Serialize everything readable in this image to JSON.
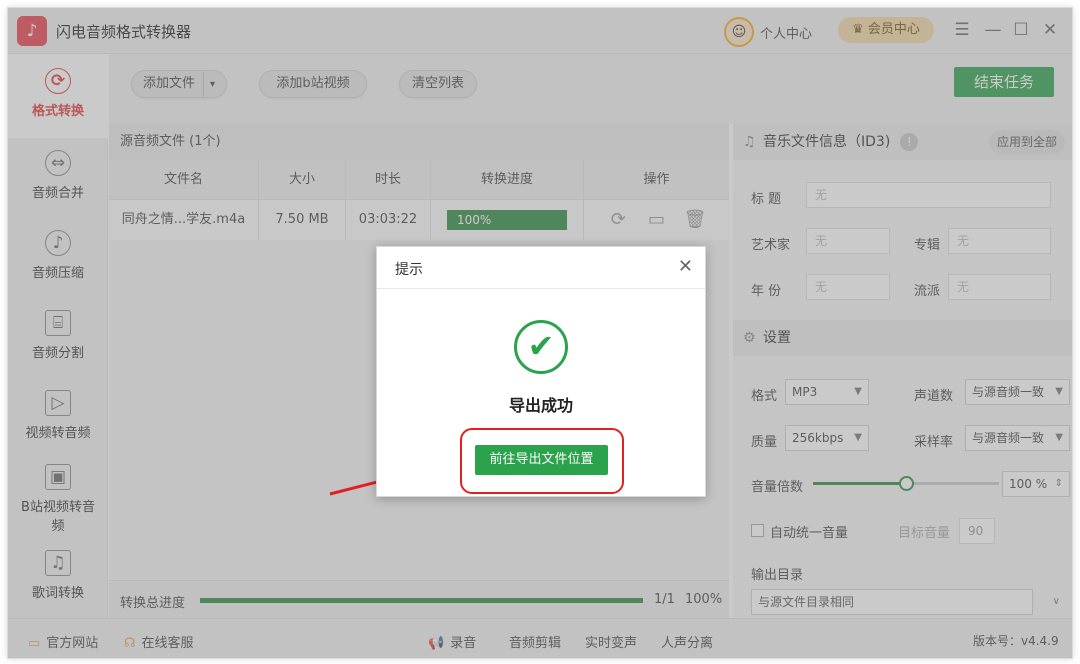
{
  "app": {
    "title": "闪电音频格式转换器",
    "logo_glyph": "♪"
  },
  "header": {
    "avatar_glyph": "☺",
    "personal_center": "个人中心",
    "vip_center": "会员中心",
    "menu_glyph": "☰",
    "minimize_glyph": "—",
    "maximize_glyph": "☐",
    "close_glyph": "✕"
  },
  "sidebar": {
    "items": [
      {
        "label": "格式转换",
        "icon": "refresh-icon",
        "glyph": "⟳"
      },
      {
        "label": "音频合并",
        "icon": "merge-icon",
        "glyph": "⇔"
      },
      {
        "label": "音频压缩",
        "icon": "music-note-icon",
        "glyph": "♪"
      },
      {
        "label": "音频分割",
        "icon": "split-icon",
        "glyph": "⌸"
      },
      {
        "label": "视频转音频",
        "icon": "video-file-icon",
        "glyph": "▷"
      },
      {
        "label": "B站视频转音频",
        "icon": "bilibili-icon",
        "glyph": "▣"
      },
      {
        "label": "歌词转换",
        "icon": "lyrics-icon",
        "glyph": "♫"
      }
    ]
  },
  "toolbar": {
    "add_file": "添加文件",
    "add_file_dropdown": "▾",
    "add_bilibili": "添加b站视频",
    "clear_list": "清空列表",
    "end_task": "结束任务"
  },
  "file_panel": {
    "header": "源音频文件 (1个)",
    "columns": [
      "文件名",
      "大小",
      "时长",
      "转换进度",
      "操作"
    ],
    "rows": [
      {
        "name": "同舟之情...学友.m4a",
        "size": "7.50 MB",
        "duration": "03:03:22",
        "progress_label": "100%",
        "progress": 1.0
      }
    ],
    "op_glyphs": {
      "reconvert": "⟳",
      "open_folder": "▭",
      "delete": "🗑"
    },
    "total_label": "转换总进度",
    "total_count": "1/1",
    "total_percent": "100%",
    "total_progress": 1.0
  },
  "right_panel": {
    "id3_title": "音乐文件信息（ID3)",
    "id3_info_glyph": "!",
    "apply_all": "应用到全部",
    "fields": {
      "title_label": "标 题",
      "artist_label": "艺术家",
      "album_label": "专辑",
      "year_label": "年 份",
      "genre_label": "流派",
      "placeholder": "无"
    },
    "settings_title": "设置",
    "format_label": "格式",
    "format_value": "MP3",
    "channels_label": "声道数",
    "channels_value": "与源音频一致",
    "quality_label": "质量",
    "quality_value": "256kbps",
    "sample_rate_label": "采样率",
    "sample_rate_value": "与源音频一致",
    "volume_label": "音量倍数",
    "volume_value": "100",
    "volume_unit": "%",
    "volume_fraction": 0.5,
    "auto_volume_label": "自动统一音量",
    "target_volume_label": "目标音量",
    "target_volume_value": "90",
    "output_dir_label": "输出目录",
    "output_dir_value": "与源文件目录相同"
  },
  "statusbar": {
    "official_site": "官方网站",
    "online_support": "在线客服",
    "record": "录音",
    "audio_edit": "音频剪辑",
    "realtime_voice": "实时变声",
    "vocal_separation": "人声分离",
    "version": "版本号：v4.4.9"
  },
  "dialog": {
    "title": "提示",
    "close_glyph": "✕",
    "check_glyph": "✔",
    "message": "导出成功",
    "goto_button": "前往导出文件位置"
  },
  "colors": {
    "accent_green": "#2ba24c",
    "highlight_red": "#e3201f",
    "brand_red": "#e8424f"
  }
}
